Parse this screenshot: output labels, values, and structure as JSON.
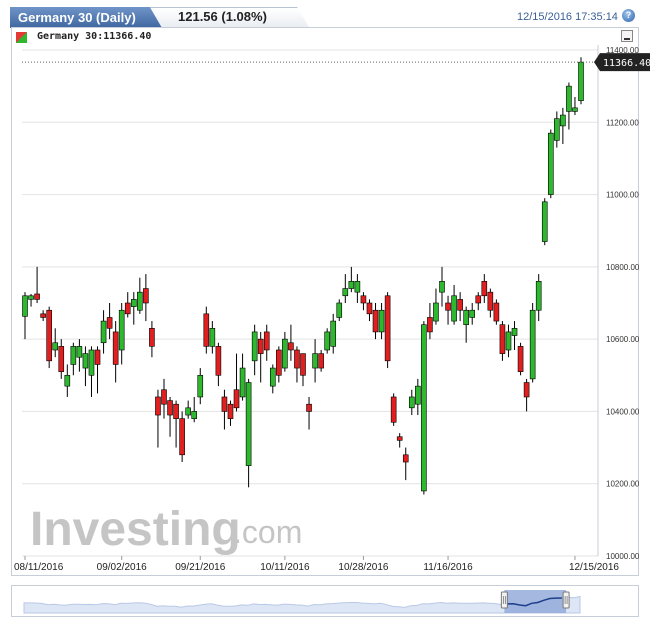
{
  "header": {
    "title": "Germany 30 (Daily)",
    "change": "121.56 (1.08%)",
    "datetime": "12/15/2016  17:35:14",
    "help_icon": "help-icon"
  },
  "legend": {
    "label": "Germany 30:11366.40",
    "minimize_icon": "minimize-icon"
  },
  "watermark": {
    "brand": "Investing",
    "suffix": ".com"
  },
  "colors": {
    "up": "#2eb82e",
    "down": "#e02020",
    "accent": "#3f679f",
    "nav_fill": "#8fa8d8"
  },
  "chart_data": {
    "type": "candlestick",
    "y_ticks": [
      "10000.00",
      "10200.00",
      "10400.00",
      "10600.00",
      "10800.00",
      "11000.00",
      "11200.00",
      "11400.00"
    ],
    "ylim": [
      10000,
      11400
    ],
    "x_ticks": [
      {
        "label": "08/11/2016",
        "index": 0
      },
      {
        "label": "09/02/2016",
        "index": 16
      },
      {
        "label": "09/21/2016",
        "index": 29
      },
      {
        "label": "10/11/2016",
        "index": 43
      },
      {
        "label": "10/28/2016",
        "index": 56
      },
      {
        "label": "11/16/2016",
        "index": 70
      },
      {
        "label": "12/15/2016",
        "index": 91
      }
    ],
    "last_value": "11366.40",
    "last_close": 11366.4,
    "candles": [
      [
        10663,
        10720,
        10730,
        10600
      ],
      [
        10710,
        10720,
        10725,
        10690
      ],
      [
        10725,
        10710,
        10800,
        10700
      ],
      [
        10670,
        10660,
        10680,
        10650
      ],
      [
        10680,
        10540,
        10690,
        10520
      ],
      [
        10570,
        10590,
        10630,
        10550
      ],
      [
        10580,
        10510,
        10600,
        10490
      ],
      [
        10470,
        10500,
        10530,
        10440
      ],
      [
        10530,
        10580,
        10590,
        10500
      ],
      [
        10550,
        10580,
        10600,
        10510
      ],
      [
        10520,
        10560,
        10580,
        10470
      ],
      [
        10500,
        10570,
        10580,
        10440
      ],
      [
        10570,
        10530,
        10580,
        10450
      ],
      [
        10590,
        10650,
        10680,
        10560
      ],
      [
        10660,
        10630,
        10700,
        10600
      ],
      [
        10620,
        10530,
        10650,
        10480
      ],
      [
        10570,
        10680,
        10700,
        10530
      ],
      [
        10700,
        10670,
        10730,
        10660
      ],
      [
        10690,
        10710,
        10730,
        10640
      ],
      [
        10680,
        10730,
        10770,
        10670
      ],
      [
        10740,
        10700,
        10780,
        10650
      ],
      [
        10630,
        10580,
        10650,
        10550
      ],
      [
        10440,
        10390,
        10460,
        10300
      ],
      [
        10460,
        10420,
        10490,
        10380
      ],
      [
        10430,
        10390,
        10440,
        10330
      ],
      [
        10420,
        10380,
        10430,
        10300
      ],
      [
        10380,
        10280,
        10400,
        10260
      ],
      [
        10390,
        10410,
        10430,
        10380
      ],
      [
        10380,
        10400,
        10440,
        10370
      ],
      [
        10440,
        10500,
        10520,
        10420
      ],
      [
        10670,
        10580,
        10690,
        10560
      ],
      [
        10580,
        10630,
        10650,
        10560
      ],
      [
        10580,
        10500,
        10590,
        10470
      ],
      [
        10440,
        10400,
        10460,
        10350
      ],
      [
        10420,
        10380,
        10430,
        10360
      ],
      [
        10460,
        10410,
        10560,
        10400
      ],
      [
        10440,
        10520,
        10560,
        10430
      ],
      [
        10250,
        10480,
        10490,
        10190
      ],
      [
        10540,
        10620,
        10640,
        10500
      ],
      [
        10600,
        10560,
        10620,
        10480
      ],
      [
        10620,
        10570,
        10640,
        10540
      ],
      [
        10470,
        10520,
        10530,
        10450
      ],
      [
        10570,
        10500,
        10580,
        10480
      ],
      [
        10520,
        10600,
        10620,
        10510
      ],
      [
        10590,
        10570,
        10640,
        10540
      ],
      [
        10570,
        10520,
        10580,
        10480
      ],
      [
        10560,
        10500,
        10560,
        10470
      ],
      [
        10420,
        10400,
        10440,
        10350
      ],
      [
        10520,
        10560,
        10600,
        10480
      ],
      [
        10560,
        10520,
        10570,
        10510
      ],
      [
        10570,
        10620,
        10630,
        10560
      ],
      [
        10580,
        10650,
        10670,
        10560
      ],
      [
        10660,
        10700,
        10710,
        10650
      ],
      [
        10720,
        10740,
        10780,
        10700
      ],
      [
        10740,
        10760,
        10800,
        10730
      ],
      [
        10730,
        10760,
        10780,
        10700
      ],
      [
        10720,
        10700,
        10730,
        10680
      ],
      [
        10700,
        10670,
        10710,
        10650
      ],
      [
        10680,
        10620,
        10700,
        10600
      ],
      [
        10620,
        10680,
        10700,
        10600
      ],
      [
        10720,
        10540,
        10730,
        10520
      ],
      [
        10440,
        10370,
        10450,
        10360
      ],
      [
        10330,
        10320,
        10340,
        10300
      ],
      [
        10280,
        10260,
        10300,
        10210
      ],
      [
        10410,
        10440,
        10460,
        10390
      ],
      [
        10420,
        10470,
        10490,
        10390
      ],
      [
        10180,
        10640,
        10650,
        10170
      ],
      [
        10660,
        10620,
        10700,
        10600
      ],
      [
        10650,
        10700,
        10740,
        10640
      ],
      [
        10730,
        10760,
        10800,
        10690
      ],
      [
        10700,
        10680,
        10720,
        10640
      ],
      [
        10650,
        10720,
        10750,
        10640
      ],
      [
        10710,
        10680,
        10730,
        10650
      ],
      [
        10640,
        10680,
        10690,
        10590
      ],
      [
        10660,
        10680,
        10700,
        10640
      ],
      [
        10720,
        10700,
        10730,
        10680
      ],
      [
        10760,
        10720,
        10780,
        10700
      ],
      [
        10730,
        10680,
        10740,
        10660
      ],
      [
        10700,
        10650,
        10710,
        10640
      ],
      [
        10640,
        10560,
        10650,
        10540
      ],
      [
        10570,
        10620,
        10640,
        10550
      ],
      [
        10610,
        10630,
        10650,
        10570
      ],
      [
        10580,
        10510,
        10590,
        10500
      ],
      [
        10480,
        10440,
        10490,
        10400
      ],
      [
        10490,
        10680,
        10700,
        10480
      ],
      [
        10680,
        10760,
        10780,
        10650
      ],
      [
        10870,
        10980,
        10990,
        10860
      ],
      [
        11000,
        11170,
        11180,
        10990
      ],
      [
        11150,
        11210,
        11230,
        11130
      ],
      [
        11190,
        11220,
        11240,
        11140
      ],
      [
        11230,
        11300,
        11310,
        11180
      ],
      [
        11230,
        11240,
        11270,
        11220
      ],
      [
        11260,
        11366.4,
        11380,
        11250
      ]
    ],
    "navigator_window": [
      0.81,
      0.975
    ]
  }
}
